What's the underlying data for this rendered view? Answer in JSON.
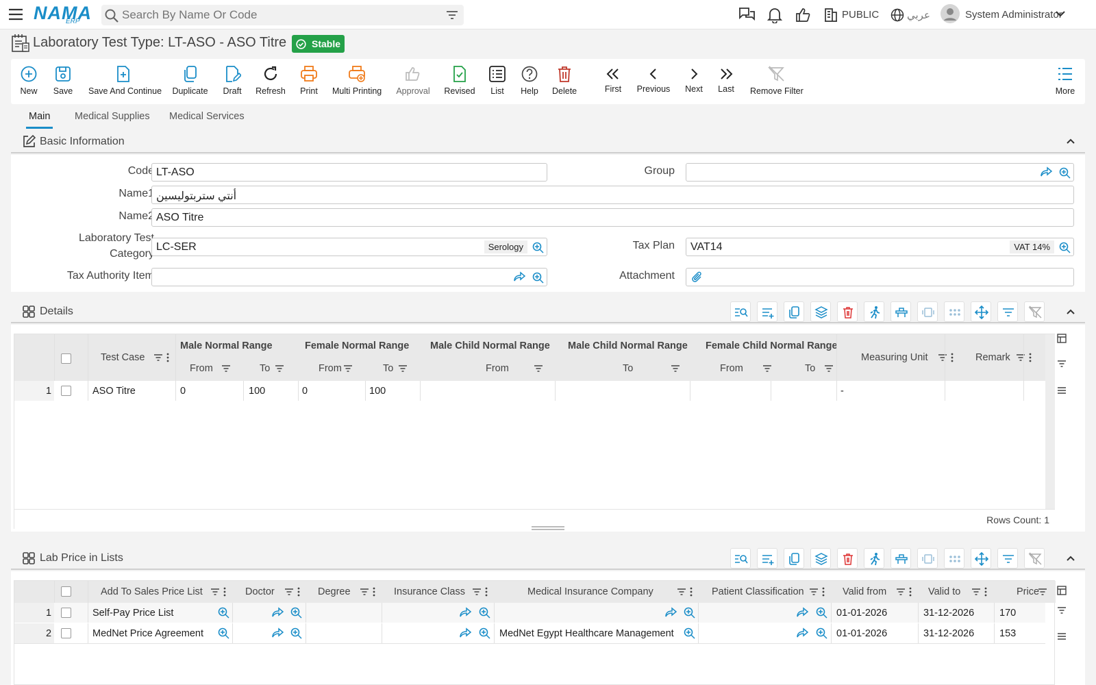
{
  "app": {
    "logo_text": "NAMA",
    "logo_sub": "ERP",
    "brand_color": "#1a8dc8"
  },
  "topbar": {
    "search_placeholder": "Search By Name Or Code",
    "public_label": "PUBLIC",
    "language_label": "عربي",
    "user_name": "System Administrator"
  },
  "page": {
    "title": "Laboratory Test Type: LT-ASO - ASO Titre",
    "status": "Stable",
    "status_color": "#24a148"
  },
  "toolbar": {
    "new": "New",
    "save": "Save",
    "save_continue": "Save And Continue",
    "duplicate": "Duplicate",
    "draft": "Draft",
    "refresh": "Refresh",
    "print": "Print",
    "multi_printing": "Multi Printing",
    "approval": "Approval",
    "revised": "Revised",
    "list": "List",
    "help": "Help",
    "delete": "Delete",
    "first": "First",
    "previous": "Previous",
    "next": "Next",
    "last": "Last",
    "remove_filter": "Remove Filter",
    "more": "More"
  },
  "tabs": [
    "Main",
    "Medical Supplies",
    "Medical Services"
  ],
  "basic": {
    "title": "Basic Information",
    "code_label": "Code",
    "code_value": "LT-ASO",
    "group_label": "Group",
    "group_value": "",
    "name1_label": "Name1",
    "name1_value": "أنتي ستربتوليسين",
    "name2_label": "Name2",
    "name2_value": "ASO Titre",
    "category_label_1": "Laboratory Test",
    "category_label_2": "Category",
    "category_value": "LC-SER",
    "category_ref": "Serology",
    "taxplan_label": "Tax Plan",
    "taxplan_value": "VAT14",
    "taxplan_ref": "VAT 14%",
    "taxauth_label": "Tax Authority Item",
    "taxauth_value": "",
    "attachment_label": "Attachment"
  },
  "details": {
    "title": "Details",
    "columns": {
      "test_case": "Test Case",
      "male": "Male Normal Range",
      "female": "Female Normal Range",
      "male_child_from": "Male Child Normal Range",
      "male_child_to": "Male Child Normal Range",
      "female_child": "Female Child Normal Range",
      "from": "From",
      "to": "To",
      "measuring_unit": "Measuring Unit",
      "remark": "Remark"
    },
    "rows": [
      {
        "num": "1",
        "test_case": "ASO Titre",
        "male_from": "0",
        "male_to": "100",
        "female_from": "0",
        "female_to": "100",
        "measuring_unit": "-"
      }
    ],
    "rows_count": "Rows Count: 1"
  },
  "prices": {
    "title": "Lab Price in Lists",
    "columns": {
      "price_list": "Add To Sales Price List",
      "doctor": "Doctor",
      "degree": "Degree",
      "insurance_class": "Insurance Class",
      "company": "Medical Insurance Company",
      "patient_class": "Patient Classification",
      "valid_from": "Valid from",
      "valid_to": "Valid to",
      "price": "Price"
    },
    "rows": [
      {
        "num": "1",
        "price_list": "Self-Pay Price List",
        "company": "",
        "valid_from": "01-01-2026",
        "valid_to": "31-12-2026",
        "price": "170"
      },
      {
        "num": "2",
        "price_list": "MedNet Price Agreement",
        "company": "MedNet Egypt Healthcare Management",
        "valid_from": "01-01-2026",
        "valid_to": "31-12-2026",
        "price": "153"
      }
    ]
  }
}
